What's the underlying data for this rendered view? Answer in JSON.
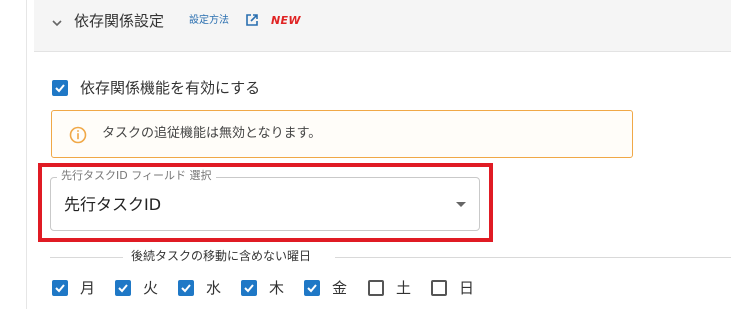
{
  "section": {
    "title": "依存関係設定",
    "help_link": "設定方法",
    "new_badge": "NEW"
  },
  "dependency": {
    "enable_label": "依存関係機能を有効にする",
    "enabled": true
  },
  "notice": {
    "text": "タスクの追従機能は無効となります。",
    "color": "#f0a847"
  },
  "select": {
    "legend": "先行タスクID フィールド 選択",
    "value": "先行タスクID"
  },
  "weekdays": {
    "title": "後続タスクの移動に含めない曜日",
    "days": [
      {
        "label": "月",
        "checked": true
      },
      {
        "label": "火",
        "checked": true
      },
      {
        "label": "水",
        "checked": true
      },
      {
        "label": "木",
        "checked": true
      },
      {
        "label": "金",
        "checked": true
      },
      {
        "label": "土",
        "checked": false
      },
      {
        "label": "日",
        "checked": false
      }
    ]
  },
  "colors": {
    "accent": "#1f78c6",
    "highlight": "#e01b24",
    "new_badge": "#e02424",
    "link": "#2a6fb0"
  }
}
